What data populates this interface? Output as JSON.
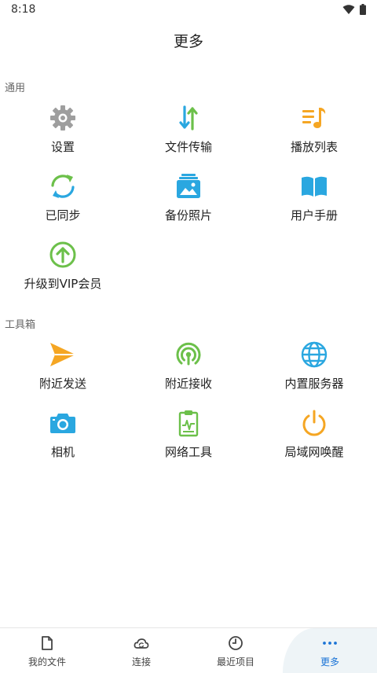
{
  "status_bar": {
    "time": "8:18"
  },
  "header": {
    "title": "更多"
  },
  "sections": {
    "general": {
      "label": "通用",
      "items": [
        {
          "label": "设置",
          "icon": "gear-icon"
        },
        {
          "label": "文件传输",
          "icon": "transfer-arrows-icon"
        },
        {
          "label": "播放列表",
          "icon": "playlist-icon"
        },
        {
          "label": "已同步",
          "icon": "sync-icon"
        },
        {
          "label": "备份照片",
          "icon": "photo-backup-icon"
        },
        {
          "label": "用户手册",
          "icon": "book-icon"
        },
        {
          "label": "升级到VIP会员",
          "icon": "upgrade-arrow-icon"
        }
      ]
    },
    "tools": {
      "label": "工具箱",
      "items": [
        {
          "label": "附近发送",
          "icon": "paper-plane-icon"
        },
        {
          "label": "附近接收",
          "icon": "radar-receive-icon"
        },
        {
          "label": "内置服务器",
          "icon": "globe-icon"
        },
        {
          "label": "相机",
          "icon": "camera-icon"
        },
        {
          "label": "网络工具",
          "icon": "clipboard-pulse-icon"
        },
        {
          "label": "局域网唤醒",
          "icon": "power-icon"
        }
      ]
    }
  },
  "bottom_nav": {
    "tabs": [
      {
        "label": "我的文件",
        "icon": "file-icon"
      },
      {
        "label": "连接",
        "icon": "cloud-sync-icon"
      },
      {
        "label": "最近项目",
        "icon": "clock-icon"
      },
      {
        "label": "更多",
        "icon": "more-dots-icon",
        "active": true
      }
    ]
  },
  "colors": {
    "gray_icon": "#9e9e9e",
    "blue_icon": "#2aa7e0",
    "green_icon": "#6cc04a",
    "orange_icon": "#f5a623",
    "active_tab": "#1a73d6"
  }
}
